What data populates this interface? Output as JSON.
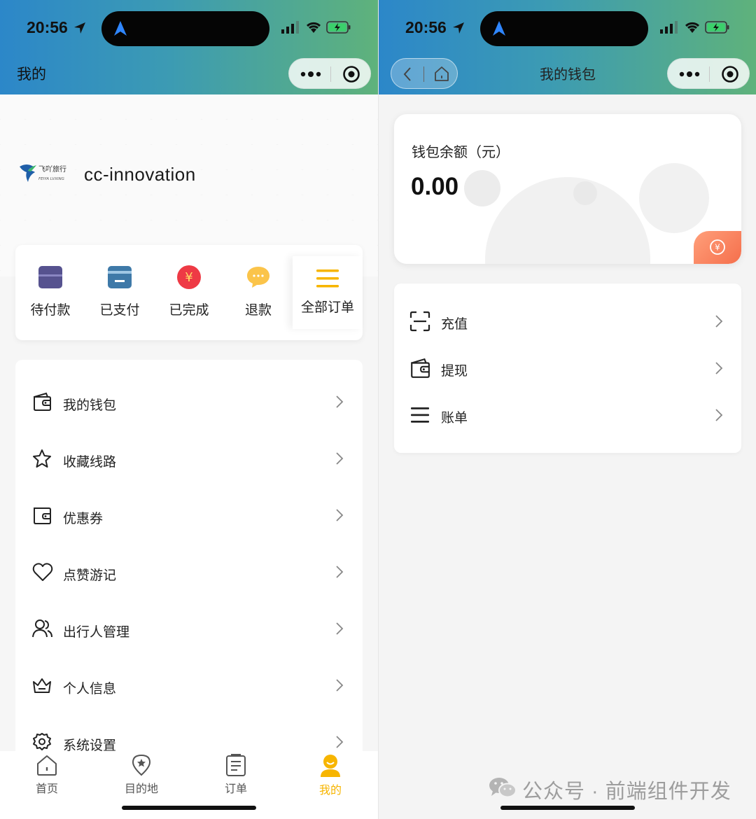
{
  "status": {
    "time": "20:56"
  },
  "colors": {
    "accent": "#f7b500",
    "header_start": "#2c87c9",
    "header_end": "#5fb27b",
    "coin": "#f56f4c"
  },
  "left": {
    "title": "我的",
    "username": "cc-innovation",
    "logo": {
      "text_cn": "飞吖旅行",
      "text_en": "FEIYA LVXING"
    },
    "orders": [
      {
        "label": "待付款",
        "icon": "pending-payment-icon"
      },
      {
        "label": "已支付",
        "icon": "paid-card-icon"
      },
      {
        "label": "已完成",
        "icon": "completed-yen-icon"
      },
      {
        "label": "退款",
        "icon": "refund-chat-icon"
      }
    ],
    "all_orders": "全部订单",
    "menu": [
      {
        "label": "我的钱包",
        "icon": "wallet-icon"
      },
      {
        "label": "收藏线路",
        "icon": "star-icon"
      },
      {
        "label": "优惠券",
        "icon": "coupon-icon"
      },
      {
        "label": "点赞游记",
        "icon": "heart-icon"
      },
      {
        "label": "出行人管理",
        "icon": "users-icon"
      },
      {
        "label": "个人信息",
        "icon": "profile-basket-icon"
      },
      {
        "label": "系统设置",
        "icon": "gear-icon"
      }
    ],
    "tabs": [
      {
        "label": "首页",
        "icon": "home-icon"
      },
      {
        "label": "目的地",
        "icon": "location-star-icon"
      },
      {
        "label": "订单",
        "icon": "order-list-icon"
      },
      {
        "label": "我的",
        "icon": "smiley-user-icon"
      }
    ]
  },
  "right": {
    "title": "我的钱包",
    "balance_label": "钱包余额（元）",
    "balance": "0.00",
    "actions": [
      {
        "label": "充值",
        "icon": "scan-frame-icon"
      },
      {
        "label": "提现",
        "icon": "wallet-icon"
      },
      {
        "label": "账单",
        "icon": "list-icon"
      }
    ],
    "watermark": "公众号 · 前端组件开发"
  }
}
